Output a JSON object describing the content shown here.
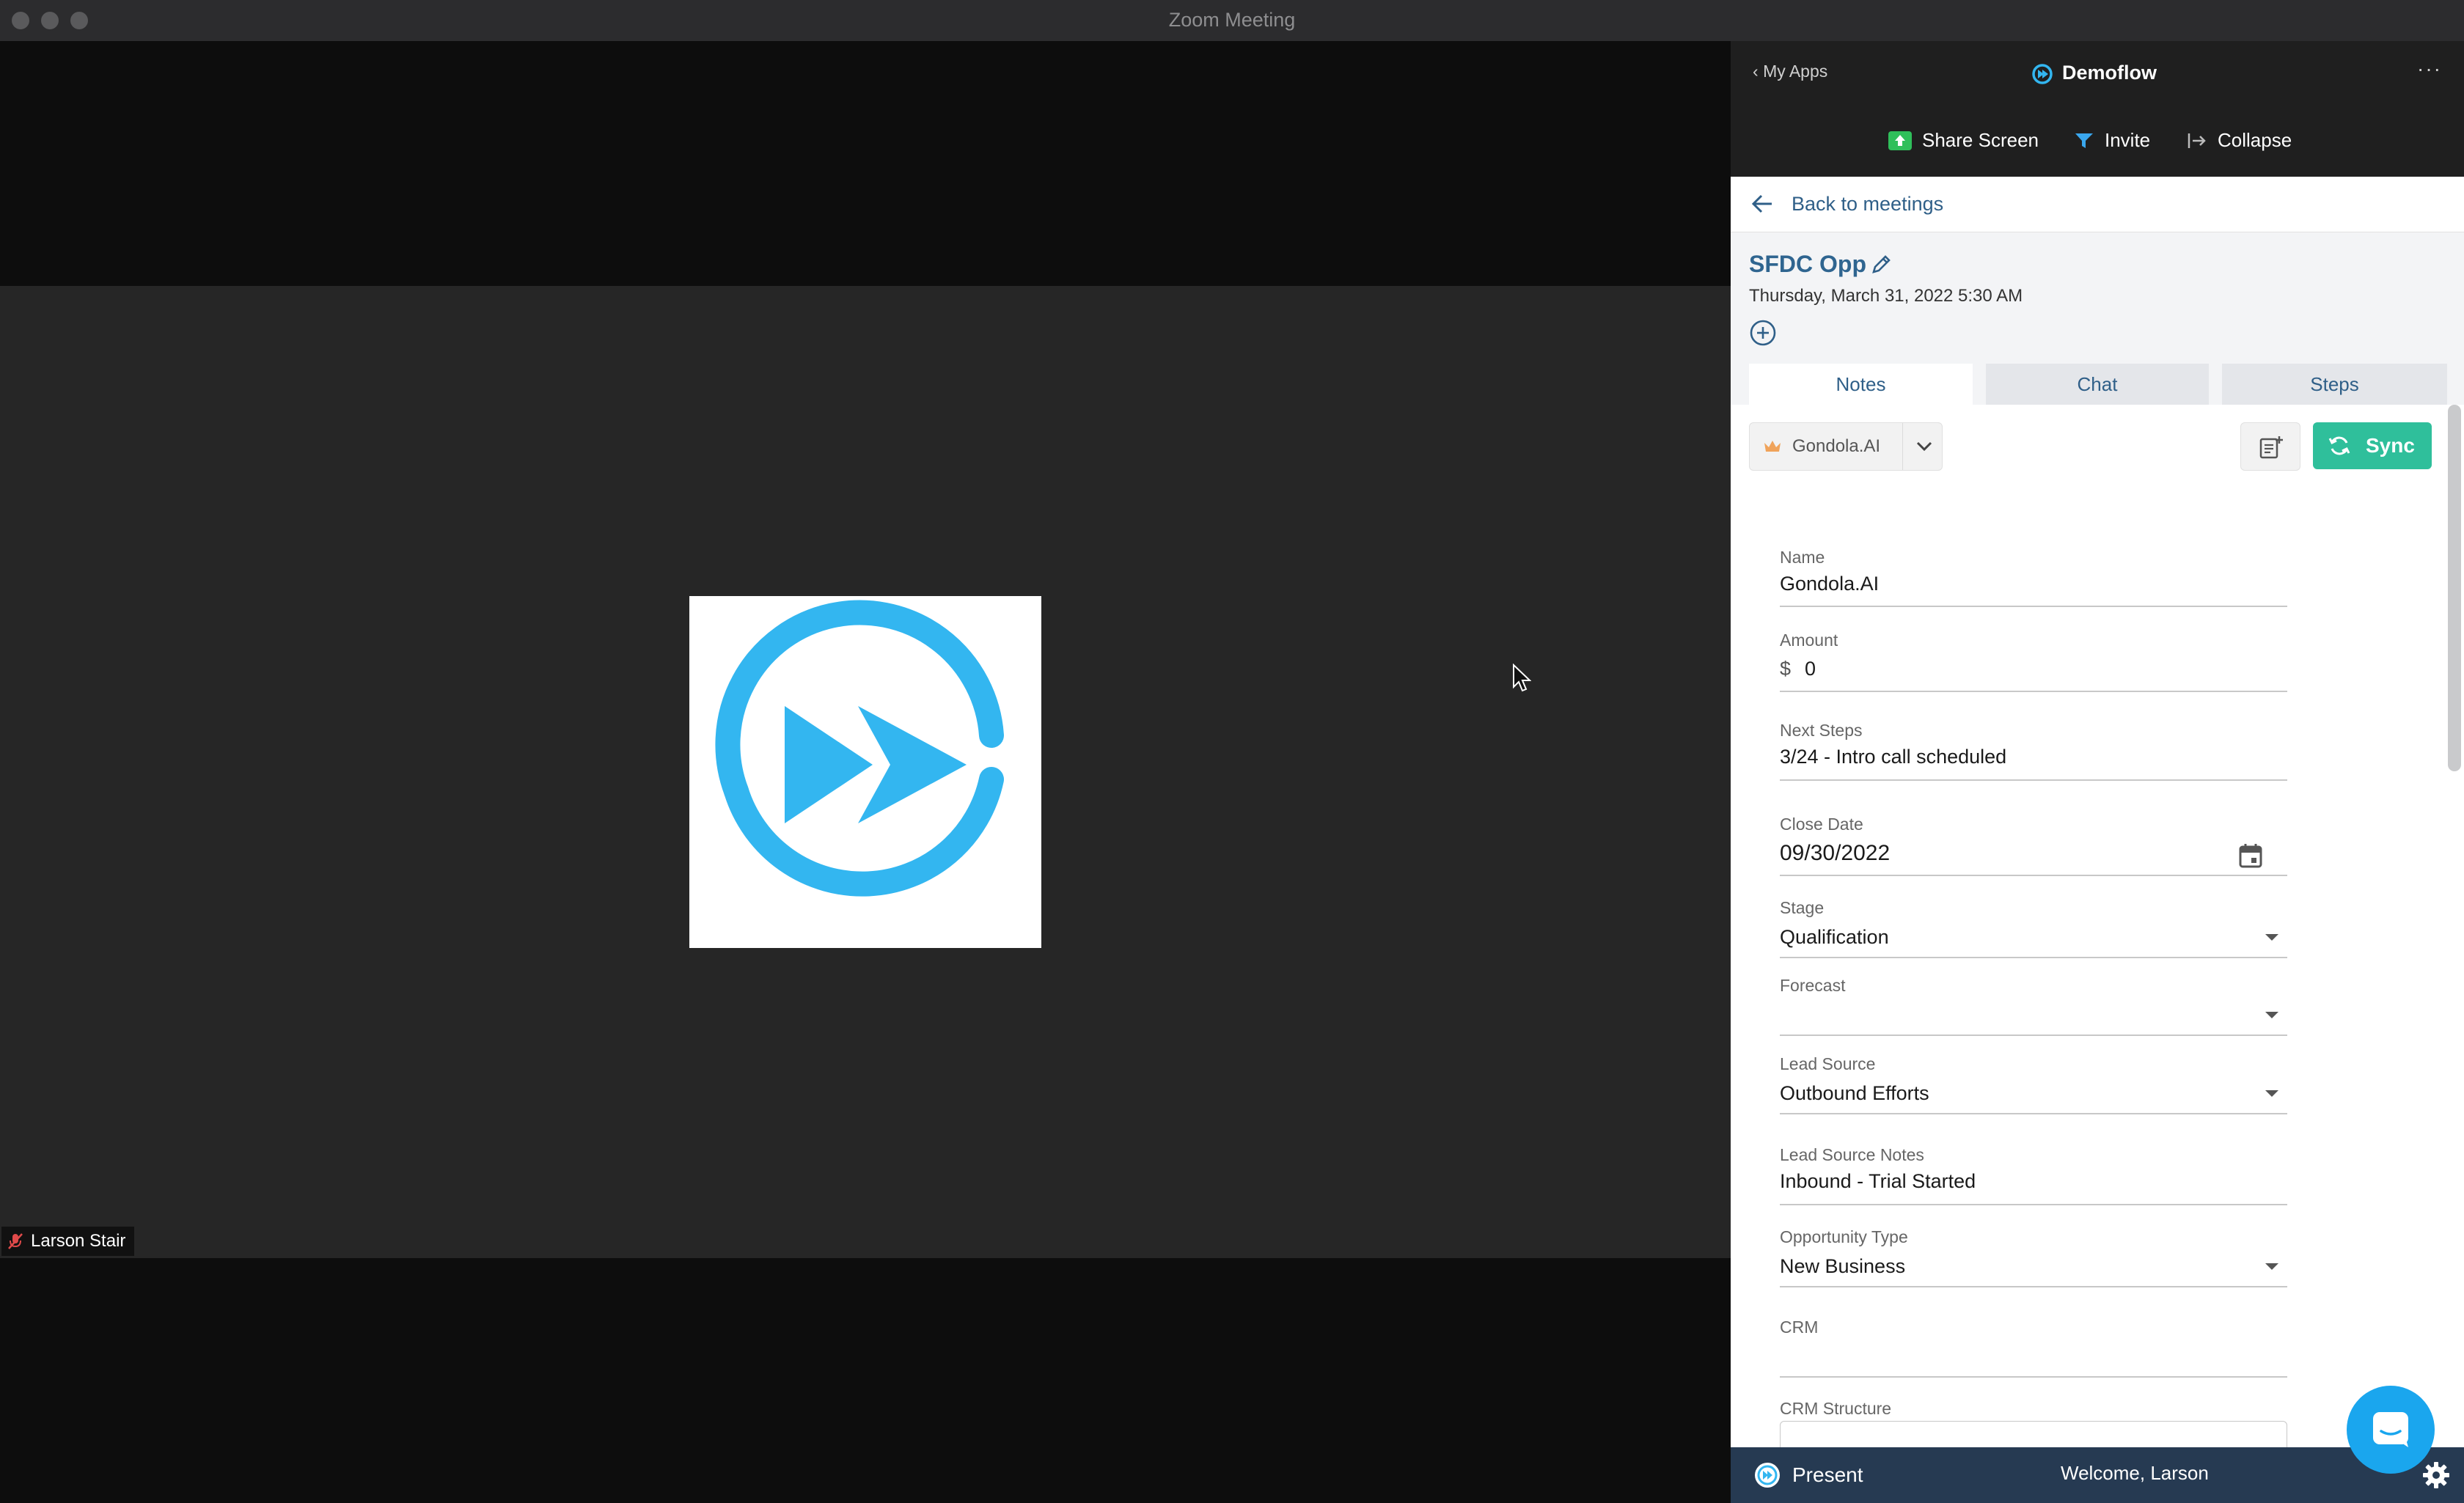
{
  "window": {
    "title": "Zoom Meeting"
  },
  "participant": {
    "name": "Larson Stair"
  },
  "panel": {
    "back_apps": "My Apps",
    "app_name": "Demoflow",
    "more": "···",
    "share_screen": "Share Screen",
    "invite": "Invite",
    "collapse": "Collapse",
    "back_to_meetings": "Back to meetings",
    "opportunity": {
      "title": "SFDC Opp",
      "datetime": "Thursday, March 31, 2022 5:30 AM"
    },
    "tabs": [
      {
        "label": "Notes",
        "active": true
      },
      {
        "label": "Chat",
        "active": false
      },
      {
        "label": "Steps",
        "active": false
      }
    ],
    "account_dropdown": "Gondola.AI",
    "sync_label": "Sync",
    "fields": {
      "name": {
        "label": "Name",
        "value": "Gondola.AI"
      },
      "amount": {
        "label": "Amount",
        "currency": "$",
        "value": "0"
      },
      "next_steps": {
        "label": "Next Steps",
        "value": "3/24 - Intro call scheduled"
      },
      "close_date": {
        "label": "Close Date",
        "value": "09/30/2022"
      },
      "stage": {
        "label": "Stage",
        "value": "Qualification"
      },
      "forecast": {
        "label": "Forecast",
        "value": ""
      },
      "lead_source": {
        "label": "Lead Source",
        "value": "Outbound Efforts"
      },
      "lead_source_notes": {
        "label": "Lead Source Notes",
        "value": "Inbound - Trial Started"
      },
      "opportunity_type": {
        "label": "Opportunity Type",
        "value": "New Business"
      },
      "crm": {
        "label": "CRM",
        "value": ""
      },
      "crm_structure": {
        "label": "CRM Structure",
        "value": ""
      }
    },
    "footer": {
      "present": "Present",
      "welcome": "Welcome, Larson"
    }
  },
  "colors": {
    "accent_blue": "#2f6590",
    "sync_green": "#2fbf9b",
    "footer_navy": "#263a52",
    "logo_blue": "#33b6f0"
  }
}
